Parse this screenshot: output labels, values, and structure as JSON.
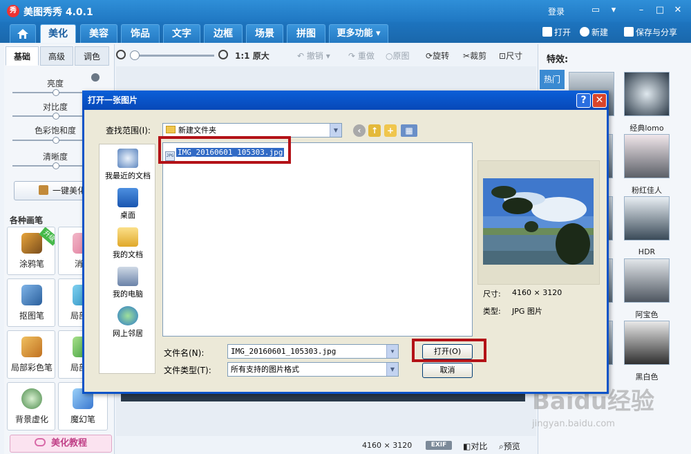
{
  "app": {
    "title": "美图秀秀 4.0.1",
    "logo_text": "秀",
    "login": "登录"
  },
  "main_tabs": [
    {
      "label": "美化"
    },
    {
      "label": "美容"
    },
    {
      "label": "饰品"
    },
    {
      "label": "文字"
    },
    {
      "label": "边框"
    },
    {
      "label": "场景"
    },
    {
      "label": "拼图"
    },
    {
      "label": "更多功能 ▾"
    }
  ],
  "top_actions": {
    "open": "打开",
    "new": "新建",
    "save_share": "保存与分享"
  },
  "left_panel": {
    "subtabs": [
      "基础",
      "高级",
      "调色"
    ],
    "sliders": [
      {
        "label": "亮度",
        "value": 0.5
      },
      {
        "label": "对比度",
        "value": 0.5
      },
      {
        "label": "色彩饱和度",
        "value": 0.5
      },
      {
        "label": "清晰度",
        "value": 0.5
      }
    ],
    "one_click": "一键美化",
    "brushes_title": "各种画笔",
    "brushes": [
      {
        "label": "涂鸦笔",
        "badge": "升级"
      },
      {
        "label": "消除"
      },
      {
        "label": "抠图笔"
      },
      {
        "label": "局部马"
      },
      {
        "label": "局部彩色笔"
      },
      {
        "label": "局部变"
      },
      {
        "label": "背景虚化"
      },
      {
        "label": "魔幻笔"
      }
    ],
    "tutorial": "美化教程"
  },
  "toolbar": {
    "zoom_level": 0.0,
    "actual_size": "原大",
    "undo": "撤销",
    "redo": "重做",
    "original": "原图",
    "rotate": "旋转",
    "crop": "裁剪",
    "resize": "尺寸"
  },
  "status": {
    "dimensions": "4160 × 3120",
    "exif": "EXIF",
    "compare": "对比",
    "preview": "预览"
  },
  "effects": {
    "title": "特效:",
    "hot_tab": "热门",
    "items": [
      "经典lomo",
      "粉红佳人",
      "HDR",
      "阿宝色",
      "黑白色"
    ]
  },
  "watermark": {
    "text": "Baidu经验",
    "sub": "jingyan.baidu.com"
  },
  "dialog": {
    "title": "打开一张图片",
    "look_in_label": "查找范围(I):",
    "look_in_value": "新建文件夹",
    "places": [
      "我最近的文档",
      "桌面",
      "我的文档",
      "我的电脑",
      "网上邻居"
    ],
    "files": [
      {
        "name": "IMG_20160601_105303.jpg",
        "selected": true
      }
    ],
    "file_name_label": "文件名(N):",
    "file_name_value": "IMG_20160601_105303.jpg",
    "file_type_label": "文件类型(T):",
    "file_type_value": "所有支持的图片格式",
    "open_button": "打开(O)",
    "cancel_button": "取消",
    "info_size_label": "尺寸:",
    "info_size_value": "4160 × 3120",
    "info_type_label": "类型:",
    "info_type_value": "JPG 图片"
  },
  "colors": {
    "title_blue": "#1f77c2",
    "dialog_blue": "#0a53c8",
    "highlight_red": "#b31217",
    "selection_blue": "#316ac5"
  }
}
